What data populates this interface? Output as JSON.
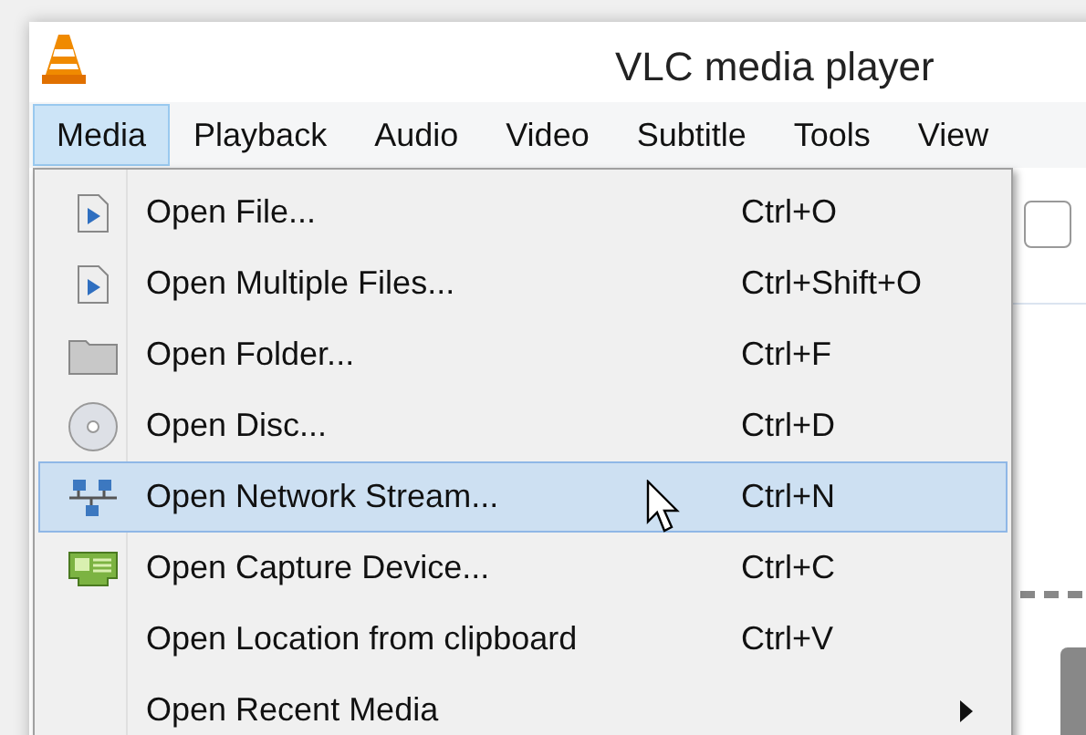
{
  "window": {
    "title": "VLC media player"
  },
  "menubar": [
    {
      "label": "Media",
      "selected": true
    },
    {
      "label": "Playback",
      "selected": false
    },
    {
      "label": "Audio",
      "selected": false
    },
    {
      "label": "Video",
      "selected": false
    },
    {
      "label": "Subtitle",
      "selected": false
    },
    {
      "label": "Tools",
      "selected": false
    },
    {
      "label": "View",
      "selected": false
    }
  ],
  "menu": [
    {
      "kind": "file",
      "label": "Open File...",
      "shortcut": "Ctrl+O",
      "selected": false
    },
    {
      "kind": "file",
      "label": "Open Multiple Files...",
      "shortcut": "Ctrl+Shift+O",
      "selected": false
    },
    {
      "kind": "folder",
      "label": "Open Folder...",
      "shortcut": "Ctrl+F",
      "selected": false
    },
    {
      "kind": "disc",
      "label": "Open Disc...",
      "shortcut": "Ctrl+D",
      "selected": false
    },
    {
      "kind": "network",
      "label": "Open Network Stream...",
      "shortcut": "Ctrl+N",
      "selected": true
    },
    {
      "kind": "capture",
      "label": "Open Capture Device...",
      "shortcut": "Ctrl+C",
      "selected": false
    },
    {
      "kind": "plain",
      "label": "Open Location from clipboard",
      "shortcut": "Ctrl+V",
      "selected": false
    },
    {
      "kind": "submenu",
      "label": "Open Recent Media",
      "selected": false
    }
  ]
}
